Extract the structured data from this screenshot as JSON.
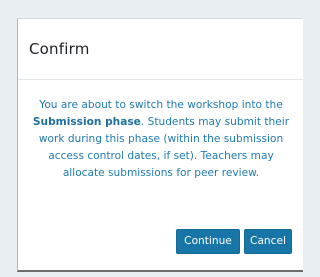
{
  "dialog": {
    "title": "Confirm",
    "message_before": "You are about to switch the workshop into the ",
    "message_bold": "Submission phase",
    "message_after": ". Students may submit their work during this phase (within the submission access control dates, if set). Teachers may allocate submissions for peer review.",
    "continue_label": "Continue",
    "cancel_label": "Cancel"
  },
  "colors": {
    "backdrop": "#e9eef2",
    "message_text": "#1f7bb0",
    "primary_button": "#1775a8"
  }
}
